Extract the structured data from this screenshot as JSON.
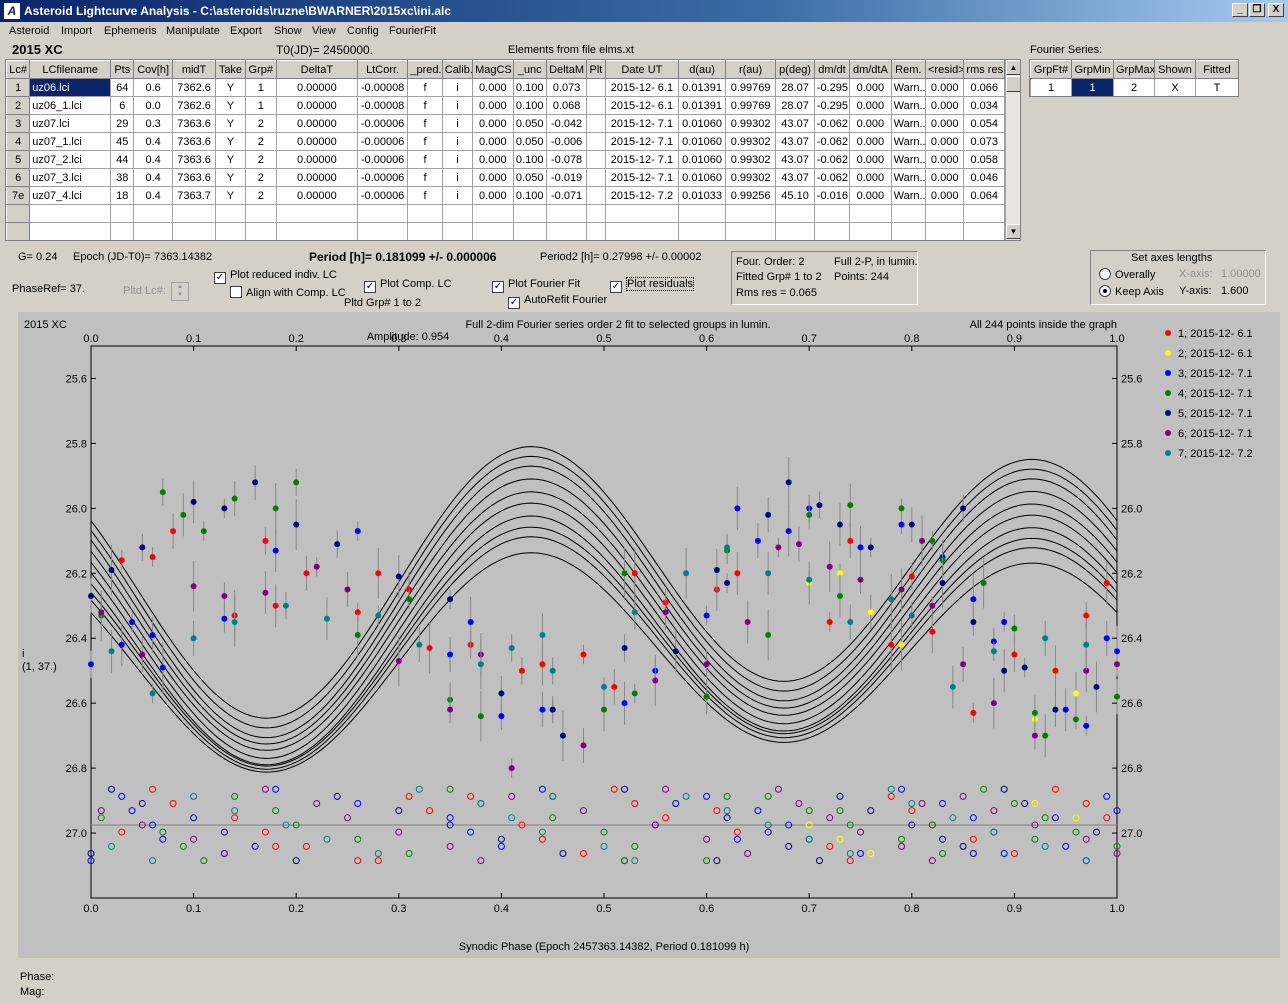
{
  "window": {
    "title": "Asteroid Lightcurve Analysis - C:\\asteroids\\ruzne\\BWARNER\\2015xc\\ini.alc",
    "icon": "app-logo-icon",
    "buttons": {
      "minimize": "_",
      "restore": "❐",
      "close": "X"
    }
  },
  "menu": [
    "Asteroid",
    "Import",
    "Ephemeris",
    "Manipulate",
    "Export",
    "Show",
    "View",
    "Config",
    "FourierFit"
  ],
  "header": {
    "asteroid": "2015 XC",
    "t0": "T0(JD)= 2450000.",
    "elements": "Elements from file elms.xt",
    "fourier_label": "Fourier Series:"
  },
  "lc_table": {
    "columns": [
      "Lc#",
      "LCfilename",
      "Pts",
      "Cov[h]",
      "midT",
      "Take",
      "Grp#",
      "DeltaT",
      "LtCorr.",
      "_pred.",
      "Calib.",
      "MagCS",
      "_unc",
      "DeltaM",
      "Plt",
      "Date UT",
      "d(au)",
      "r(au)",
      "p(deg)",
      "dm/dt",
      "dm/dtA",
      "Rem.",
      "<resid>",
      "rms res"
    ],
    "rows": [
      [
        "1",
        "uz06.lci",
        "64",
        "0.6",
        "7362.6",
        "Y",
        "1",
        "0.00000",
        "-0.00008",
        "f",
        "i",
        "0.000",
        "0.100",
        "0.073",
        "",
        "2015-12- 6.1",
        "0.01391",
        "0.99769",
        "28.07",
        "-0.295",
        "0.000",
        "Warn..",
        "0.000",
        "0.066"
      ],
      [
        "2",
        "uz06_1.lci",
        "6",
        "0.0",
        "7362.6",
        "Y",
        "1",
        "0.00000",
        "-0.00008",
        "f",
        "i",
        "0.000",
        "0.100",
        "0.068",
        "",
        "2015-12- 6.1",
        "0.01391",
        "0.99769",
        "28.07",
        "-0.295",
        "0.000",
        "Warn..",
        "0.000",
        "0.034"
      ],
      [
        "3",
        "uz07.lci",
        "29",
        "0.3",
        "7363.6",
        "Y",
        "2",
        "0.00000",
        "-0.00006",
        "f",
        "i",
        "0.000",
        "0.050",
        "-0.042",
        "",
        "2015-12- 7.1",
        "0.01060",
        "0.99302",
        "43.07",
        "-0.062",
        "0.000",
        "Warn..",
        "0.000",
        "0.054"
      ],
      [
        "4",
        "uz07_1.lci",
        "45",
        "0.4",
        "7363.6",
        "Y",
        "2",
        "0.00000",
        "-0.00006",
        "f",
        "i",
        "0.000",
        "0.050",
        "-0.006",
        "",
        "2015-12- 7.1",
        "0.01060",
        "0.99302",
        "43.07",
        "-0.062",
        "0.000",
        "Warn..",
        "0.000",
        "0.073"
      ],
      [
        "5",
        "uz07_2.lci",
        "44",
        "0.4",
        "7363.6",
        "Y",
        "2",
        "0.00000",
        "-0.00006",
        "f",
        "i",
        "0.000",
        "0.100",
        "-0.078",
        "",
        "2015-12- 7.1",
        "0.01060",
        "0.99302",
        "43.07",
        "-0.062",
        "0.000",
        "Warn..",
        "0.000",
        "0.058"
      ],
      [
        "6",
        "uz07_3.lci",
        "38",
        "0.4",
        "7363.6",
        "Y",
        "2",
        "0.00000",
        "-0.00006",
        "f",
        "i",
        "0.000",
        "0.050",
        "-0.019",
        "",
        "2015-12- 7.1",
        "0.01060",
        "0.99302",
        "43.07",
        "-0.062",
        "0.000",
        "Warn..",
        "0.000",
        "0.046"
      ],
      [
        "7e",
        "uz07_4.lci",
        "18",
        "0.4",
        "7363.7",
        "Y",
        "2",
        "0.00000",
        "-0.00006",
        "f",
        "i",
        "0.000",
        "0.100",
        "-0.071",
        "",
        "2015-12- 7.2",
        "0.01033",
        "0.99256",
        "45.10",
        "-0.016",
        "0.000",
        "Warn..",
        "0.000",
        "0.064"
      ]
    ]
  },
  "fourier_table": {
    "columns": [
      "GrpFt#",
      "GrpMin",
      "GrpMax",
      "Shown",
      "Fitted"
    ],
    "rows": [
      [
        "1",
        "1",
        "2",
        "X",
        "T"
      ]
    ]
  },
  "info": {
    "g": "G= 0.24",
    "epoch": "Epoch (JD-T0)= 7363.14382",
    "period": "Period [h]= 0.181099 +/- 0.000006",
    "period2": "Period2 [h]= 0.27998 +/- 0.00002",
    "phaseref": "PhaseRef= 37.",
    "pltd_lc": "Pltd Lc#:",
    "pltd_grp": "Pltd Grp#  1   to   2",
    "four_order": "Four. Order:  2",
    "fitted_grp": "Fitted Grp# 1 to 2",
    "rms_res": "Rms res     = 0.065",
    "full2p": "Full 2-P, in lumin.",
    "points": "Points: 244"
  },
  "options": {
    "plot_reduced": "Plot reduced indiv. LC",
    "align": "Align with Comp. LC",
    "plot_comp": "Plot Comp. LC",
    "plot_fourier": "Plot Fourier Fit",
    "autorefit": "AutoRefit Fourier",
    "plot_resid": "Plot residuals"
  },
  "axes_box": {
    "title": "Set axes lengths",
    "overally": "Overally",
    "keep": "Keep Axis",
    "xaxis_lbl": "X-axis:",
    "xaxis_val": "1.00000",
    "yaxis_lbl": "Y-axis:",
    "yaxis_val": "1.600"
  },
  "status": {
    "phase": "Phase:",
    "mag": "Mag:"
  },
  "chart_data": {
    "type": "scatter",
    "title_left": "2015 XC",
    "title": "Full 2-dim Fourier series order 2 fit to selected groups in lumin.",
    "subtitle": "Amplitude: 0.954",
    "title_right": "All 244 points inside the graph",
    "xlabel": "Synodic Phase (Epoch 2457363.14382, Period 0.181099 h)",
    "ylabel": "i",
    "ylabel2": "(1, 37.)",
    "xlim": [
      0,
      1
    ],
    "ylim": [
      27.2,
      25.5
    ],
    "xticks": [
      "0.0",
      "0.1",
      "0.2",
      "0.3",
      "0.4",
      "0.5",
      "0.6",
      "0.7",
      "0.8",
      "0.9",
      "1.0"
    ],
    "yticks": [
      "25.6",
      "25.8",
      "26.0",
      "26.2",
      "26.4",
      "26.6",
      "26.8",
      "27.0"
    ],
    "residual_baseline": 26.975,
    "series": [
      {
        "name": "1; 2015-12- 6.1",
        "color": "#ff0000",
        "offset": 0.06,
        "points": [
          [
            0.06,
            26.15
          ],
          [
            0.08,
            26.07
          ],
          [
            0.14,
            26.33
          ],
          [
            0.17,
            26.1
          ],
          [
            0.18,
            26.3
          ],
          [
            0.26,
            26.32
          ],
          [
            0.31,
            26.25
          ],
          [
            0.33,
            26.43
          ],
          [
            0.42,
            26.5
          ],
          [
            0.44,
            26.48
          ],
          [
            0.48,
            26.45
          ],
          [
            0.51,
            26.55
          ],
          [
            0.53,
            26.2
          ],
          [
            0.56,
            26.29
          ],
          [
            0.63,
            26.2
          ],
          [
            0.72,
            26.35
          ],
          [
            0.74,
            26.1
          ],
          [
            0.78,
            26.42
          ],
          [
            0.8,
            26.21
          ],
          [
            0.82,
            26.38
          ],
          [
            0.86,
            26.63
          ],
          [
            0.9,
            26.45
          ],
          [
            0.94,
            26.5
          ],
          [
            0.97,
            26.33
          ],
          [
            0.99,
            26.23
          ],
          [
            0.03,
            26.16
          ],
          [
            0.21,
            26.2
          ],
          [
            0.28,
            26.2
          ],
          [
            0.37,
            26.42
          ],
          [
            0.61,
            26.25
          ]
        ]
      },
      {
        "name": "2; 2015-12- 6.1",
        "color": "#ffff00",
        "offset": 0.04,
        "points": [
          [
            0.7,
            26.23
          ],
          [
            0.73,
            26.2
          ],
          [
            0.76,
            26.32
          ],
          [
            0.79,
            26.42
          ],
          [
            0.92,
            26.65
          ],
          [
            0.96,
            26.57
          ]
        ]
      },
      {
        "name": "3; 2015-12- 7.1",
        "color": "#0000ff",
        "offset": 0.0,
        "points": [
          [
            0.0,
            26.48
          ],
          [
            0.03,
            26.42
          ],
          [
            0.04,
            26.35
          ],
          [
            0.06,
            26.39
          ],
          [
            0.07,
            26.49
          ],
          [
            0.13,
            26.34
          ],
          [
            0.18,
            26.13
          ],
          [
            0.26,
            26.07
          ],
          [
            0.35,
            26.45
          ],
          [
            0.37,
            26.35
          ],
          [
            0.4,
            26.64
          ],
          [
            0.52,
            26.6
          ],
          [
            0.6,
            26.33
          ],
          [
            0.65,
            26.1
          ],
          [
            0.68,
            26.07
          ],
          [
            0.7,
            26.0
          ],
          [
            0.75,
            26.12
          ],
          [
            0.79,
            26.05
          ],
          [
            0.83,
            26.15
          ],
          [
            0.86,
            26.28
          ],
          [
            0.88,
            26.41
          ],
          [
            0.95,
            26.62
          ],
          [
            0.97,
            26.67
          ],
          [
            0.99,
            26.4
          ],
          [
            1.0,
            26.44
          ],
          [
            0.55,
            26.5
          ],
          [
            0.63,
            26.0
          ],
          [
            0.89,
            26.35
          ],
          [
            0.44,
            26.62
          ]
        ]
      },
      {
        "name": "4; 2015-12- 7.1",
        "color": "#008000",
        "offset": -0.03,
        "points": [
          [
            0.01,
            26.33
          ],
          [
            0.07,
            25.95
          ],
          [
            0.09,
            26.02
          ],
          [
            0.11,
            26.07
          ],
          [
            0.14,
            25.97
          ],
          [
            0.18,
            26.0
          ],
          [
            0.2,
            25.92
          ],
          [
            0.26,
            26.39
          ],
          [
            0.31,
            26.28
          ],
          [
            0.35,
            26.59
          ],
          [
            0.38,
            26.64
          ],
          [
            0.45,
            26.62
          ],
          [
            0.5,
            26.62
          ],
          [
            0.53,
            26.57
          ],
          [
            0.6,
            26.58
          ],
          [
            0.66,
            26.39
          ],
          [
            0.7,
            26.02
          ],
          [
            0.74,
            25.99
          ],
          [
            0.79,
            26.0
          ],
          [
            0.83,
            26.16
          ],
          [
            0.87,
            26.23
          ],
          [
            0.9,
            26.37
          ],
          [
            0.93,
            26.7
          ],
          [
            0.96,
            26.65
          ],
          [
            1.0,
            26.58
          ],
          [
            0.52,
            26.2
          ],
          [
            0.62,
            26.13
          ],
          [
            0.73,
            26.27
          ],
          [
            0.82,
            26.1
          ],
          [
            0.92,
            26.63
          ]
        ]
      },
      {
        "name": "5; 2015-12- 7.1",
        "color": "#000080",
        "offset": -0.05,
        "points": [
          [
            0.0,
            26.27
          ],
          [
            0.02,
            26.19
          ],
          [
            0.05,
            26.12
          ],
          [
            0.1,
            25.98
          ],
          [
            0.13,
            26.0
          ],
          [
            0.16,
            25.92
          ],
          [
            0.2,
            26.05
          ],
          [
            0.24,
            26.11
          ],
          [
            0.3,
            26.21
          ],
          [
            0.35,
            26.28
          ],
          [
            0.4,
            26.57
          ],
          [
            0.46,
            26.7
          ],
          [
            0.52,
            26.43
          ],
          [
            0.57,
            26.44
          ],
          [
            0.62,
            26.23
          ],
          [
            0.66,
            26.02
          ],
          [
            0.68,
            25.92
          ],
          [
            0.71,
            25.99
          ],
          [
            0.73,
            26.05
          ],
          [
            0.76,
            26.12
          ],
          [
            0.8,
            26.05
          ],
          [
            0.83,
            26.23
          ],
          [
            0.86,
            26.35
          ],
          [
            0.89,
            26.5
          ],
          [
            0.91,
            26.49
          ],
          [
            0.94,
            26.62
          ],
          [
            0.98,
            26.55
          ],
          [
            0.85,
            26.0
          ],
          [
            0.61,
            26.19
          ],
          [
            0.45,
            26.62
          ]
        ]
      },
      {
        "name": "6; 2015-12- 7.1",
        "color": "#800080",
        "offset": -0.08,
        "points": [
          [
            0.01,
            26.32
          ],
          [
            0.05,
            26.45
          ],
          [
            0.1,
            26.24
          ],
          [
            0.13,
            26.27
          ],
          [
            0.17,
            26.26
          ],
          [
            0.22,
            26.18
          ],
          [
            0.25,
            26.25
          ],
          [
            0.3,
            26.47
          ],
          [
            0.35,
            26.62
          ],
          [
            0.38,
            26.45
          ],
          [
            0.41,
            26.8
          ],
          [
            0.48,
            26.73
          ],
          [
            0.55,
            26.53
          ],
          [
            0.6,
            26.48
          ],
          [
            0.64,
            26.35
          ],
          [
            0.67,
            26.12
          ],
          [
            0.69,
            26.11
          ],
          [
            0.72,
            26.18
          ],
          [
            0.75,
            26.22
          ],
          [
            0.79,
            26.25
          ],
          [
            0.82,
            26.3
          ],
          [
            0.85,
            26.48
          ],
          [
            0.88,
            26.6
          ],
          [
            0.92,
            26.7
          ],
          [
            0.97,
            26.5
          ],
          [
            1.0,
            26.48
          ],
          [
            0.56,
            26.32
          ],
          [
            0.81,
            26.1
          ]
        ]
      },
      {
        "name": "7; 2015-12- 7.2",
        "color": "#008080",
        "offset": -0.1,
        "points": [
          [
            0.02,
            26.44
          ],
          [
            0.06,
            26.57
          ],
          [
            0.1,
            26.4
          ],
          [
            0.14,
            26.35
          ],
          [
            0.19,
            26.3
          ],
          [
            0.23,
            26.34
          ],
          [
            0.28,
            26.33
          ],
          [
            0.32,
            26.42
          ],
          [
            0.38,
            26.48
          ],
          [
            0.41,
            26.43
          ],
          [
            0.44,
            26.39
          ],
          [
            0.5,
            26.55
          ],
          [
            0.53,
            26.32
          ],
          [
            0.58,
            26.2
          ],
          [
            0.62,
            26.12
          ],
          [
            0.66,
            26.2
          ],
          [
            0.7,
            26.22
          ],
          [
            0.74,
            26.35
          ],
          [
            0.78,
            26.28
          ],
          [
            0.8,
            26.33
          ],
          [
            0.84,
            26.55
          ],
          [
            0.88,
            26.44
          ],
          [
            0.93,
            26.4
          ],
          [
            0.97,
            26.42
          ],
          [
            0.45,
            26.5
          ]
        ]
      }
    ]
  }
}
